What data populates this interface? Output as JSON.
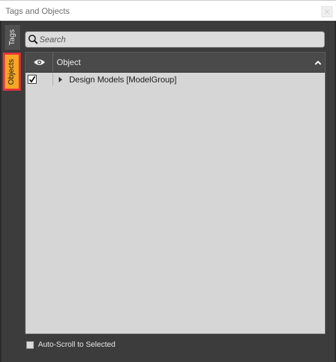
{
  "window": {
    "title": "Tags and Objects"
  },
  "side_tabs": [
    {
      "label": "Tags",
      "selected": false
    },
    {
      "label": "Objects",
      "selected": true
    }
  ],
  "search": {
    "placeholder": "Search",
    "value": ""
  },
  "tree": {
    "columns": {
      "visibility_icon": "eye-icon",
      "object_label": "Object",
      "sort_icon": "chevron-up-icon"
    },
    "rows": [
      {
        "label": "Design Models [ModelGroup]",
        "checked": true,
        "expand_icon": "caret-right-icon"
      }
    ]
  },
  "footer": {
    "auto_scroll_label": "Auto-Scroll to Selected",
    "checked": false
  },
  "colors": {
    "active_tab": "#f5a623",
    "active_tab_border": "#e8323c",
    "panel_bg": "#3c3c3c",
    "tree_bg": "#d6d6d6"
  }
}
